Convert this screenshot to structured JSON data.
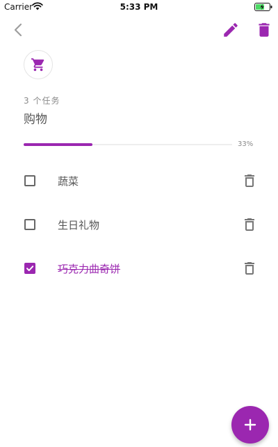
{
  "status_bar": {
    "carrier": "Carrier",
    "time": "5:33 PM"
  },
  "header": {
    "back_icon": "chevron-left-icon",
    "edit_icon": "pencil-icon",
    "delete_icon": "trash-icon"
  },
  "list": {
    "category_icon": "shopping-cart-icon",
    "task_count": "3 个任务",
    "title": "购物",
    "progress_percent": 33,
    "progress_label": "33%"
  },
  "tasks": [
    {
      "label": "蔬菜",
      "done": false
    },
    {
      "label": "生日礼物",
      "done": false
    },
    {
      "label": "巧克力曲奇饼",
      "done": true
    }
  ],
  "fab": {
    "icon": "plus-icon"
  },
  "colors": {
    "accent": "#9b27b0",
    "icon_gray": "#757575",
    "text": "#555555"
  }
}
